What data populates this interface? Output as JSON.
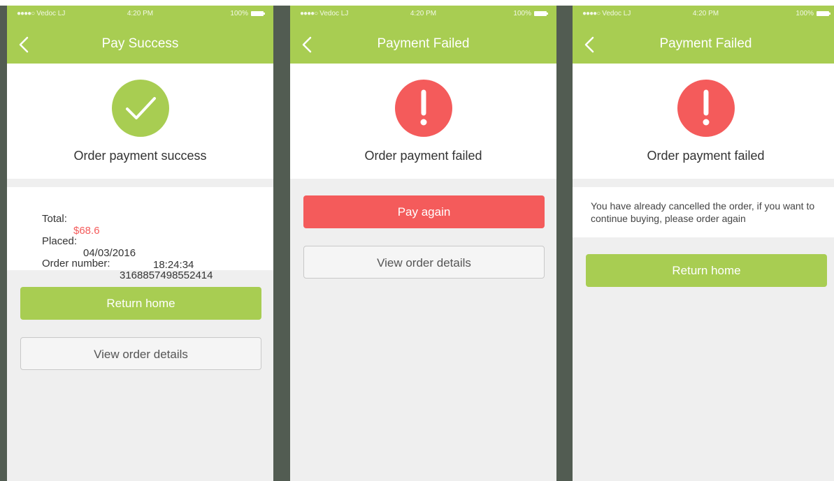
{
  "status_bar": {
    "carrier": "Vedoc LJ",
    "time": "4:20 PM",
    "battery": "100%"
  },
  "screens": [
    {
      "title": "Pay Success",
      "icon": "checkmark-circle-icon",
      "message": "Order payment success",
      "details": {
        "total_label": "Total:",
        "total_value": "$68.6",
        "placed_label": "Placed:",
        "placed_date": "04/03/2016",
        "placed_time": "18:24:34",
        "order_label": "Order number:",
        "order_value": "3168857498552414"
      },
      "primary_button": "Return home",
      "secondary_button": "View order details"
    },
    {
      "title": "Payment Failed",
      "icon": "exclamation-circle-icon",
      "message": "Order payment failed",
      "primary_button": "Pay again",
      "secondary_button": "View order details"
    },
    {
      "title": "Payment Failed",
      "icon": "exclamation-circle-icon",
      "message": "Order payment failed",
      "notice": "You have already cancelled the order, if you want to continue buying, please order again",
      "primary_button": "Return home"
    }
  ],
  "colors": {
    "brand_green": "#a8cd52",
    "error_red": "#f45b5b",
    "background": "#525c52"
  }
}
